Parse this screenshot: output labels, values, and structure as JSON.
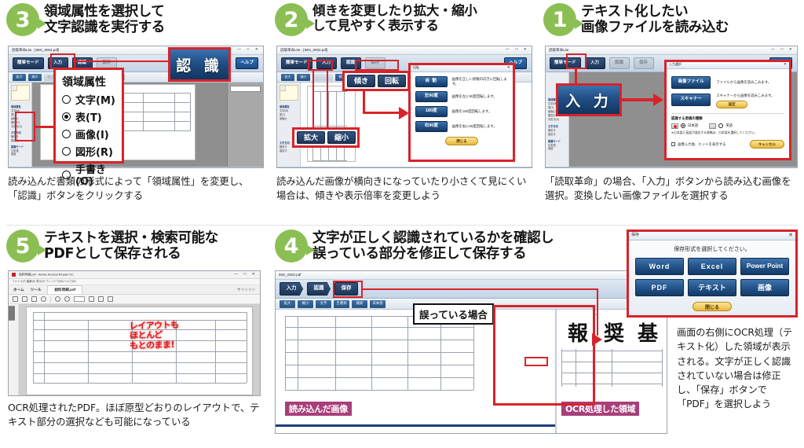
{
  "steps": {
    "s3": {
      "number": "3",
      "title_line1": "領域属性を選択して",
      "title_line2": "文字認識を実行する",
      "caption": "読み込んだ書類の形式によって「領域属性」を変更し、「認識」ボタンをクリックする",
      "window_title": "読取革命Lite - [IMG_0002.pdf]",
      "toolbar": [
        "簡単モード",
        "入力",
        "認識",
        "保存"
      ],
      "help_label": "ヘルプ",
      "subbar": [
        "拡大",
        "縮小",
        "傾き",
        "回転",
        "元に戻す"
      ],
      "overlay": {
        "title": "領域属性",
        "options": [
          {
            "label": "文字(M)",
            "selected": false
          },
          {
            "label": "表(T)",
            "selected": true
          },
          {
            "label": "画像(I)",
            "selected": false
          },
          {
            "label": "図形(R)",
            "selected": false
          },
          {
            "label": "手書き(O)",
            "selected": false
          }
        ]
      },
      "big_callout": "認 識",
      "side_panel": {
        "heading1": "領域属性",
        "items1": [
          "文字(M)",
          "表(T)",
          "画像(I)",
          "図形(R)",
          "手書き(O)"
        ],
        "heading2": "文字方向",
        "items2": [
          "横書き",
          "縦書き"
        ],
        "heading3": "認識モード",
        "items3": [
          "日本語",
          "英語"
        ]
      }
    },
    "s2": {
      "number": "2",
      "title_line1": "傾きを変更したり拡大・縮小",
      "title_line2": "して見やすく表示する",
      "caption": "読み込んだ画像が横向きになっていたり小さくて見にくい場合は、傾きや表示倍率を変更しよう",
      "window_title": "読取革命Lite - [IMG_0002.pdf]",
      "toolbar": [
        "簡単モード",
        "入力",
        "認識",
        "保存"
      ],
      "help_label": "ヘルプ",
      "callouts": [
        "傾き",
        "回転",
        "拡大",
        "縮小"
      ],
      "dialog": {
        "title": "回転",
        "rows": [
          {
            "button": "自 動",
            "text": "画像を正しい原稿の向きに回転します。"
          },
          {
            "button": "左90度",
            "text": "画像を左に90度回転します。"
          },
          {
            "button": "180度",
            "text": "画像を180度回転します。"
          },
          {
            "button": "右90度",
            "text": "画像を右に90度回転します。"
          }
        ],
        "close": "閉じる"
      }
    },
    "s1": {
      "number": "1",
      "title_line1": "テキスト化したい",
      "title_line2": "画像ファイルを読み込む",
      "caption": "「読取革命」の場合、「入力」ボタンから読み込む画像を選択。変換したい画像ファイルを選択する",
      "window_title": "読取革命Lite",
      "toolbar": [
        "簡単モード",
        "入力",
        "認識",
        "保存"
      ],
      "help_label": "ヘルプ",
      "big_callout": "入 力",
      "dialog": {
        "title": "入力選択",
        "rows": [
          {
            "button": "画像ファイル",
            "text": "ファイルから画像を読みこみます。"
          },
          {
            "button": "スキャナー",
            "text": "スキャナーから画像を読みこみます。"
          }
        ],
        "settings_btn": "設定",
        "lang_heading": "認識する原稿の種類",
        "lang_options": [
          "日本語",
          "英語"
        ],
        "note": "※日本語と英語が混在する原稿は、日本語を選択してください。",
        "checkbox": "画像入力後、ヒントを表示する",
        "cancel": "キャンセル"
      }
    },
    "s5": {
      "number": "5",
      "title_line1": "テキストを選択・検索可能な",
      "title_line2": "PDFとして保存される",
      "caption": "OCR処理されたPDF。ほぼ原型どおりのレイアウトで、テキスト部分の選択なども可能になっている",
      "window_title": "給料明細.pdf - Adobe Acrobat Reader DC",
      "menu": "ファイル(F)  編集(E)  表示(V)  ウィンドウ(W)  ヘルプ(H)",
      "tabs": [
        "ホーム",
        "ツール",
        "給料明細.pdf"
      ],
      "signin": "サインイン",
      "stamp_lines": [
        "レイアウトも",
        "ほとんど",
        "もとのまま!"
      ]
    },
    "s4": {
      "number": "4",
      "title_line1": "文字が正しく認識されているかを確認し",
      "title_line2": "誤っている部分を修正して保存する",
      "file_label": "IMG_0002.pdf",
      "toolbar": [
        "入力",
        "認識",
        "保存"
      ],
      "subbar": [
        "拡大",
        "縮小",
        "文字",
        "全選択",
        "検索",
        "日本語"
      ],
      "label_error": "誤っている場合",
      "tag_left": "読み込んだ画像",
      "tag_right": "OCR処理した領域",
      "ocr_chars": [
        "報",
        "奨",
        "基"
      ],
      "dialog": {
        "title": "保存",
        "prompt": "保存形式を選択してください。",
        "buttons": [
          "Word",
          "Excel",
          "Power Point",
          "PDF",
          "テキスト",
          "画像"
        ],
        "close": "閉じる"
      },
      "side_caption": "画面の右側にOCR処理（テキスト化）した領域が表示される。文字が正しく認識されていない場合は修正し、「保存」ボタンで「PDF」を選択しよう"
    }
  },
  "colors": {
    "accent_green": "#8cbf53",
    "annotation_red": "#d8232a",
    "button_blue": "#23548a",
    "magenta_tag": "#a83f7a"
  }
}
